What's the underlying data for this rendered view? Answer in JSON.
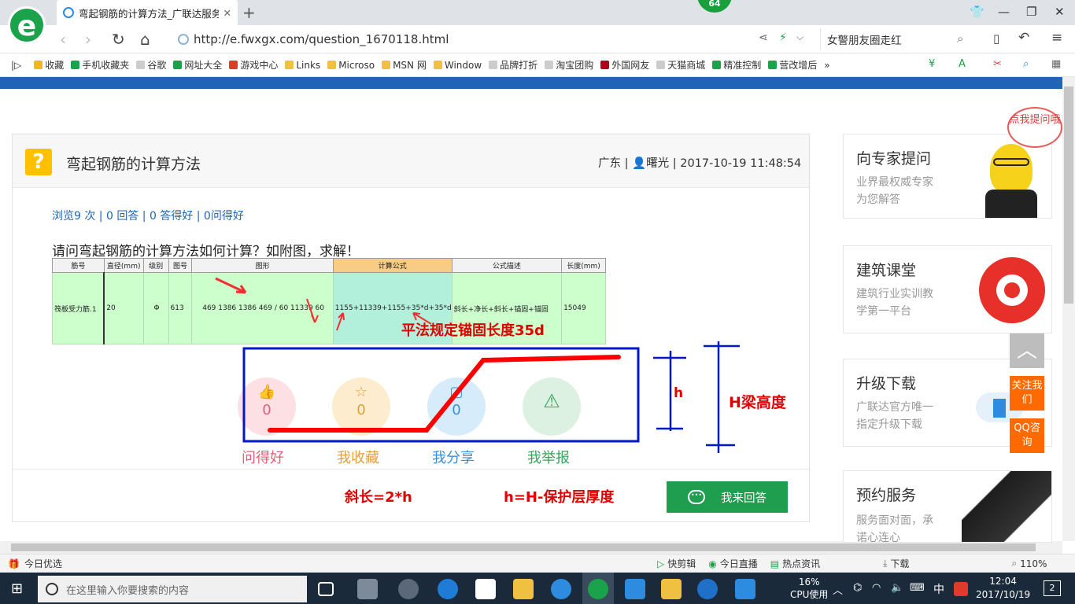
{
  "browser": {
    "tab_title": "弯起钢筋的计算方法_广联达服务",
    "tab_close": "✕",
    "new_tab": "+",
    "badge": "64",
    "logo_letter": "e",
    "url": "http://e.fwxgx.com/question_1670118.html",
    "search_text": "女警朋友圈走红",
    "accent": "#1aa34a"
  },
  "bookmarks": [
    {
      "label": "收藏",
      "color": "#f2b81a"
    },
    {
      "label": "手机收藏夹",
      "color": "#1aa34a"
    },
    {
      "label": "谷歌",
      "color": "#cccccc"
    },
    {
      "label": "网址大全",
      "color": "#1aa34a"
    },
    {
      "label": "游戏中心",
      "color": "#e03a2b"
    },
    {
      "label": "Links",
      "color": "#f0c040"
    },
    {
      "label": "Microso",
      "color": "#f0c040"
    },
    {
      "label": "MSN 网",
      "color": "#f0c040"
    },
    {
      "label": "Window",
      "color": "#f0c040"
    },
    {
      "label": "品牌打折",
      "color": "#cccccc"
    },
    {
      "label": "淘宝团购",
      "color": "#cccccc"
    },
    {
      "label": "外国网友",
      "color": "#b3001b"
    },
    {
      "label": "天猫商城",
      "color": "#cccccc"
    },
    {
      "label": "精准控制",
      "color": "#1aa34a"
    },
    {
      "label": "营改增后",
      "color": "#1aa34a"
    },
    {
      "label": "»",
      "color": ""
    }
  ],
  "question": {
    "icon": "?",
    "title": "弯起钢筋的计算方法",
    "meta": "广东 | 👤曙光 | 2017-10-19 11:48:54",
    "stats": "浏览9 次 | 0 回答 | 0 答得好 | 0问得好",
    "body": "请问弯起钢筋的计算方法如何计算？如附图，求解！"
  },
  "sheet": {
    "headers": [
      "筋号",
      "直径(mm)",
      "级别",
      "图号",
      "图形",
      "计算公式",
      "公式描述",
      "长度(mm)"
    ],
    "row": [
      "筏板受力筋.1",
      "20",
      "Φ",
      "613",
      "469   1386   1386  469 / 60   11339   60",
      "1155+11339+1155+35*d+35*d",
      "斜长+净长+斜长+锚固+锚固",
      "15049"
    ]
  },
  "actions": [
    {
      "label": "问得好",
      "count": "0",
      "icon": "👍",
      "bg": "#fde0e4",
      "color": "#e0607a"
    },
    {
      "label": "我收藏",
      "count": "0",
      "icon": "☆",
      "bg": "#fdeccd",
      "color": "#e0a040"
    },
    {
      "label": "我分享",
      "count": "0",
      "icon": "▢",
      "bg": "#d6ecfb",
      "color": "#3a8fd6"
    },
    {
      "label": "我举报",
      "count": "",
      "icon": "⚠",
      "bg": "#dcf1e2",
      "color": "#3aa35a"
    }
  ],
  "answer_button": "我来回答",
  "annotations": {
    "anchor": "平法规定锚固长度35d",
    "h": "h",
    "H": "H梁高度",
    "slope": "斜长=2*h",
    "h_formula": "h=H-保护层厚度"
  },
  "sidebar": [
    {
      "title": "向专家提问",
      "sub1": "业界最权威专家",
      "sub2": "为您解答"
    },
    {
      "title": "建筑课堂",
      "sub1": "建筑行业实训教",
      "sub2": "学第一平台"
    },
    {
      "title": "升级下载",
      "sub1": "广联达官方唯一",
      "sub2": "指定升级下载"
    },
    {
      "title": "预约服务",
      "sub1": "服务面对面，承",
      "sub2": "诺心连心"
    }
  ],
  "float": {
    "bubble": "点我提问哦",
    "follow": "关注我们",
    "qq": "QQ咨询",
    "top_icon": "︿"
  },
  "statusbar": {
    "left": "今日优选",
    "items": [
      "快剪辑",
      "今日直播",
      "热点资讯",
      "下载"
    ],
    "zoom": "110%"
  },
  "taskbar": {
    "search_placeholder": "在这里输入你要搜索的内容",
    "cpu": "16%",
    "cpu_label": "CPU使用",
    "ime": "中",
    "time": "12:04",
    "date": "2017/10/19",
    "notif": "2"
  }
}
